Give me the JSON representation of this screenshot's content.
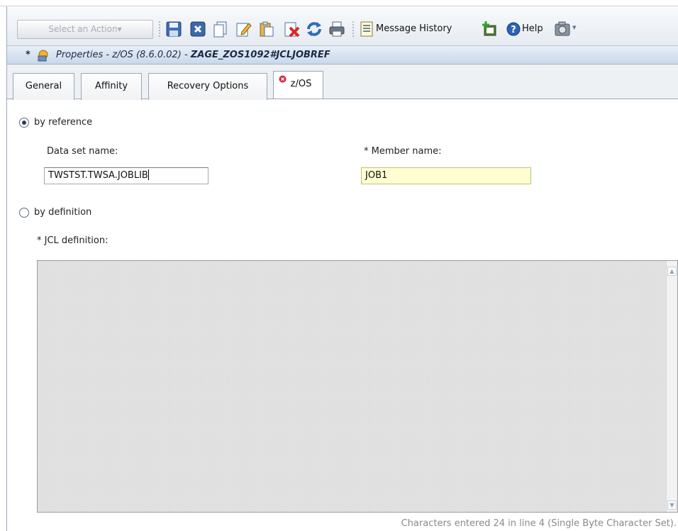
{
  "toolbar": {
    "action_select": "Select an Action▾",
    "buttons": [
      {
        "name": "save-icon"
      },
      {
        "name": "close-icon"
      },
      {
        "name": "copy-icon"
      },
      {
        "name": "edit-icon"
      },
      {
        "name": "paste-icon"
      },
      {
        "name": "delete-icon"
      },
      {
        "name": "refresh-icon"
      },
      {
        "name": "print-icon"
      }
    ],
    "message_history_label": "Message History",
    "help_label": "Help",
    "camera_dropdown": "▾"
  },
  "titlebar": {
    "asterisk": "*",
    "prefix": "Properties - z/OS (8.6.0.02) - ",
    "name": "ZAGE_ZOS1092#JCLJOBREF"
  },
  "tabs": [
    {
      "label": "General"
    },
    {
      "label": "Affinity"
    },
    {
      "label": "Recovery Options"
    },
    {
      "label": "z/OS",
      "active": true,
      "has_error": true
    }
  ],
  "form": {
    "by_reference_label": "by reference",
    "by_reference_selected": true,
    "data_set_label": "Data set name:",
    "data_set_value": "TWSTST.TWSA.JOBLIB",
    "member_label": "* Member name:",
    "member_value": "JOB1",
    "by_definition_label": "by definition",
    "by_definition_selected": false,
    "jcl_label": "* JCL definition:",
    "jcl_value": "",
    "status": "Characters entered 24 in line 4 (Single Byte Character Set)."
  },
  "colors": {
    "required_field_bg": "#ffffd2",
    "title_gradient": "#c9d8ea",
    "error_badge": "#d2263a"
  }
}
